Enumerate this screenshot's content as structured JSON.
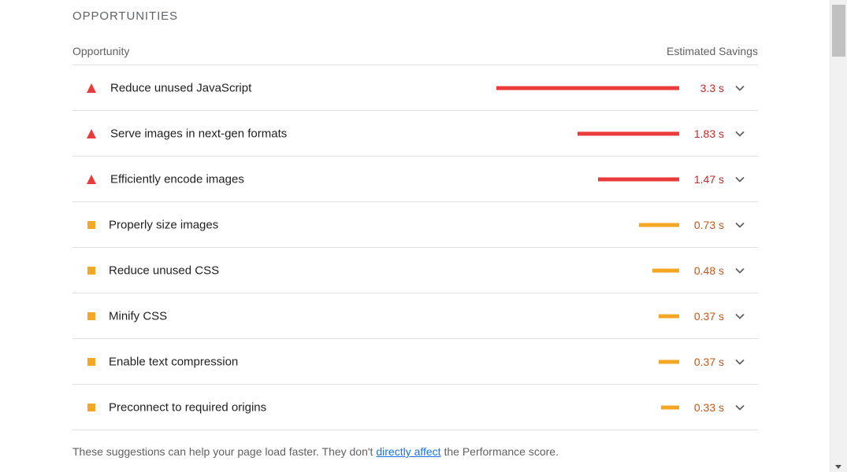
{
  "section": {
    "title": "OPPORTUNITIES"
  },
  "header": {
    "left": "Opportunity",
    "right": "Estimated Savings"
  },
  "colors": {
    "fail": "#eb3a3a",
    "average": "#f5a623",
    "link": "#1a73e8"
  },
  "opportunities": [
    {
      "icon": "red-triangle-icon",
      "status": "fail",
      "label": "Reduce unused JavaScript",
      "savings": "3.3 s",
      "bar_fraction": 1.0
    },
    {
      "icon": "red-triangle-icon",
      "status": "fail",
      "label": "Serve images in next-gen formats",
      "savings": "1.83 s",
      "bar_fraction": 0.555
    },
    {
      "icon": "red-triangle-icon",
      "status": "fail",
      "label": "Efficiently encode images",
      "savings": "1.47 s",
      "bar_fraction": 0.445
    },
    {
      "icon": "orange-square-icon",
      "status": "average",
      "label": "Properly size images",
      "savings": "0.73 s",
      "bar_fraction": 0.221
    },
    {
      "icon": "orange-square-icon",
      "status": "average",
      "label": "Reduce unused CSS",
      "savings": "0.48 s",
      "bar_fraction": 0.145
    },
    {
      "icon": "orange-square-icon",
      "status": "average",
      "label": "Minify CSS",
      "savings": "0.37 s",
      "bar_fraction": 0.112
    },
    {
      "icon": "orange-square-icon",
      "status": "average",
      "label": "Enable text compression",
      "savings": "0.37 s",
      "bar_fraction": 0.112
    },
    {
      "icon": "orange-square-icon",
      "status": "average",
      "label": "Preconnect to required origins",
      "savings": "0.33 s",
      "bar_fraction": 0.1
    }
  ],
  "footer": {
    "before": "These suggestions can help your page load faster. They don't ",
    "link": "directly affect",
    "after": " the Performance score."
  }
}
